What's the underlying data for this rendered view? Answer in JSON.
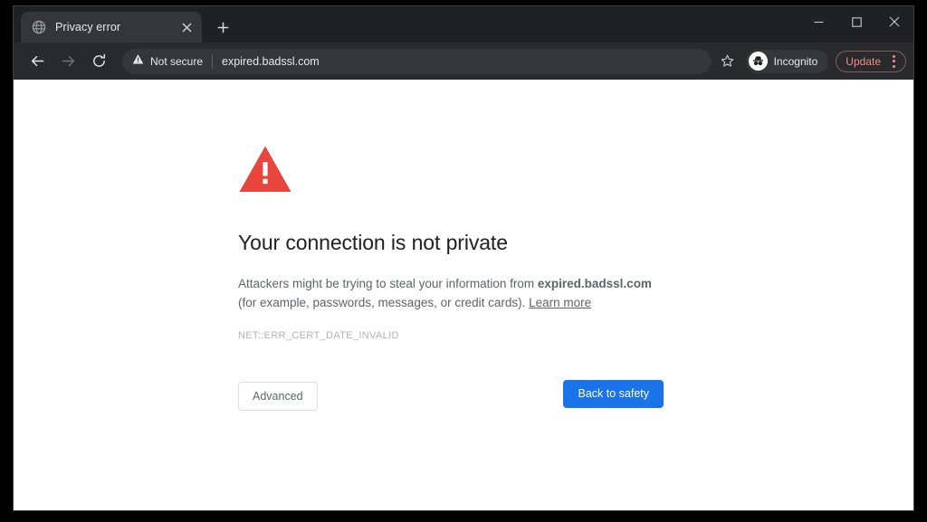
{
  "window": {
    "controls": {
      "minimize_label": "Minimize",
      "maximize_label": "Maximize",
      "close_label": "Close"
    }
  },
  "tab_strip": {
    "tabs": [
      {
        "title": "Privacy error",
        "favicon": "globe-icon",
        "close_label": "×",
        "active": true
      }
    ],
    "new_tab_label": "+"
  },
  "toolbar": {
    "back_label": "←",
    "forward_label": "→",
    "reload_label": "↻",
    "security_chip": {
      "icon": "warning-triangle-icon",
      "text": "Not secure"
    },
    "url": "expired.badssl.com",
    "bookmark_icon": "star-icon",
    "profile": {
      "icon": "incognito-spy-icon",
      "label": "Incognito"
    },
    "update": {
      "label": "Update",
      "menu_icon": "three-dots-vertical-icon",
      "accent_color": "#f28b82",
      "border_color": "#8a5a56"
    }
  },
  "interstitial": {
    "icon": "red-warning-triangle-icon",
    "icon_color": "#e8453c",
    "heading": "Your connection is not private",
    "body_before_domain": "Attackers might be trying to steal your information from ",
    "domain": "expired.badssl.com",
    "body_after_domain": " (for example, passwords, messages, or credit cards). ",
    "learn_more_label": "Learn more",
    "error_code": "NET::ERR_CERT_DATE_INVALID",
    "advanced_label": "Advanced",
    "primary_label": "Back to safety",
    "primary_color": "#1a73e8"
  }
}
